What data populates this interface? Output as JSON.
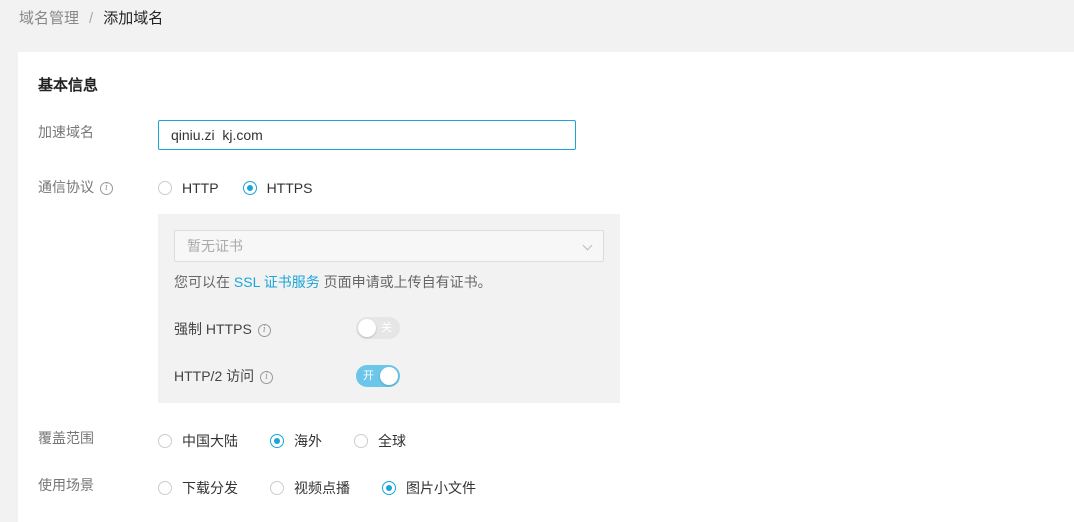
{
  "breadcrumb": {
    "parent": "域名管理",
    "separator": "/",
    "current": "添加域名"
  },
  "section": {
    "title": "基本信息"
  },
  "domain": {
    "label": "加速域名",
    "value": "qiniu.zi  kj.com"
  },
  "protocol": {
    "label": "通信协议",
    "options": [
      "HTTP",
      "HTTPS"
    ],
    "selected": "HTTPS",
    "info_icon": "info-icon"
  },
  "https_panel": {
    "cert_select_placeholder": "暂无证书",
    "hint_prefix": "您可以在",
    "hint_link": "SSL 证书服务",
    "hint_suffix": "页面申请或上传自有证书。",
    "force_https": {
      "label": "强制 HTTPS",
      "state_text": "关",
      "on": false
    },
    "http2": {
      "label": "HTTP/2 访问",
      "state_text": "开",
      "on": true
    }
  },
  "coverage": {
    "label": "覆盖范围",
    "options": [
      "中国大陆",
      "海外",
      "全球"
    ],
    "selected": "海外"
  },
  "scenario": {
    "label": "使用场景",
    "options": [
      "下载分发",
      "视频点播",
      "图片小文件"
    ],
    "selected": "图片小文件"
  },
  "colors": {
    "accent": "#1ba5d8",
    "switch_on": "#6cc6ea",
    "switch_off": "#e6e6e6"
  }
}
